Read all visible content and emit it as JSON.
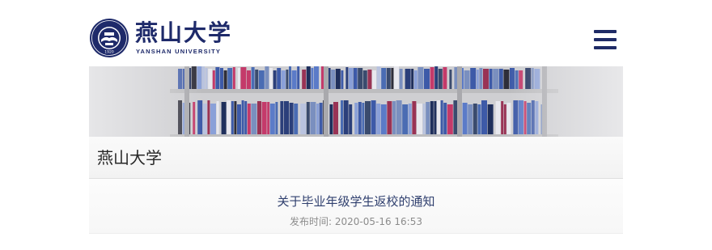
{
  "header": {
    "logo_cn": "燕山大学",
    "logo_en": "YANSHAN  UNIVERSITY",
    "seal_year": "1920",
    "menu_icon": "hamburger-menu-icon"
  },
  "banner": {
    "subject": "library bookshelves"
  },
  "site": {
    "title": "燕山大学"
  },
  "article": {
    "title": "关于毕业年级学生返校的通知",
    "meta_label": "发布时间: ",
    "date": "2020-05-16 16:53"
  },
  "colors": {
    "brand_navy": "#1e2a6a",
    "title_text": "#2f3f6e",
    "meta_text": "#8c8c8c"
  }
}
